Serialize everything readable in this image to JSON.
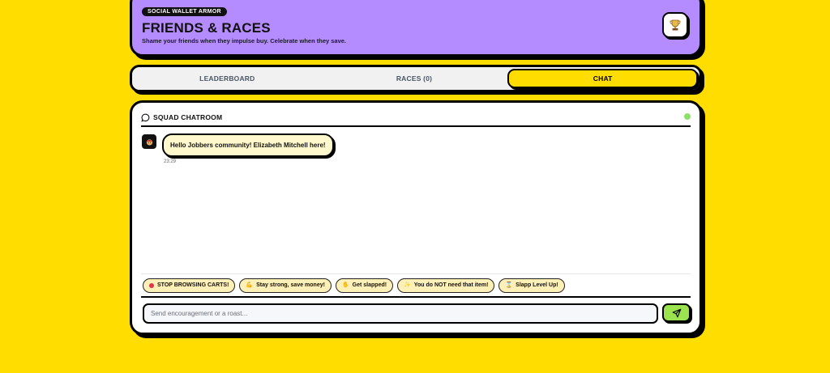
{
  "colors": {
    "background": "#FFDD00",
    "header": "#B58CFF",
    "active_tab": "#FFDD00",
    "send_button": "#9BE34F",
    "online": "#8fe06a"
  },
  "header": {
    "badge": "SOCIAL WALLET ARMOR",
    "title": "FRIENDS & RACES",
    "subtitle": "Shame your friends when they impulse buy. Celebrate when they save.",
    "icon": "trophy-icon"
  },
  "tabs": [
    {
      "label": "LEADERBOARD",
      "active": false
    },
    {
      "label": "RACES (0)",
      "active": false
    },
    {
      "label": "CHAT",
      "active": true
    }
  ],
  "chat": {
    "title": "SQUAD CHATROOM",
    "title_icon": "chat-bubble-icon",
    "status": "online",
    "messages": [
      {
        "avatar_icon": "avatar-emoji-icon",
        "text": "Hello Jobbers community! Elizabeth Mitchell here!",
        "time": "23:29"
      }
    ],
    "quick_replies": [
      {
        "icon": "red-dot-icon",
        "label": "STOP BROWSING CARTS!"
      },
      {
        "icon": "flexed-arm-icon",
        "label": "Stay strong, save money!"
      },
      {
        "icon": "hand-slap-icon",
        "label": "Get slapped!"
      },
      {
        "icon": "sparkle-icon",
        "label": "You do NOT need that item!"
      },
      {
        "icon": "hourglass-icon",
        "label": "Slapp Level Up!"
      }
    ],
    "input_placeholder": "Send encouragement or a roast...",
    "send_icon": "send-icon"
  }
}
